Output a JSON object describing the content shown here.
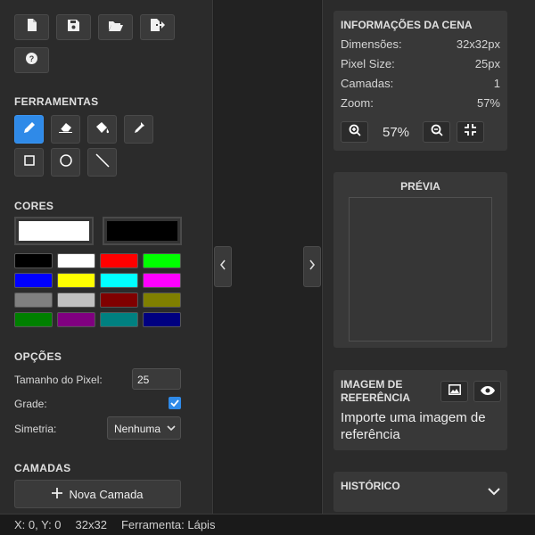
{
  "toolbar": {
    "file_buttons": [
      "new-file-icon",
      "save-icon",
      "open-folder-icon",
      "export-icon"
    ],
    "help_icon": "help-icon"
  },
  "tools": {
    "title": "FERRAMENTAS",
    "row1": [
      "pencil-icon",
      "eraser-icon",
      "fill-bucket-icon",
      "eyedropper-icon"
    ],
    "row2": [
      "square-icon",
      "circle-icon",
      "line-icon"
    ],
    "active": "pencil-icon",
    "accent": "#2f8ae8"
  },
  "colors": {
    "title": "CORES",
    "primary": "#ffffff",
    "secondary": "#000000",
    "palette": [
      "#000000",
      "#ffffff",
      "#ff0000",
      "#00ff00",
      "#0000ff",
      "#ffff00",
      "#00ffff",
      "#ff00ff",
      "#808080",
      "#c0c0c0",
      "#800000",
      "#808000",
      "#008000",
      "#800080",
      "#008080",
      "#000080"
    ]
  },
  "options": {
    "title": "OPÇÕES",
    "pixel_size_label": "Tamanho do Pixel:",
    "pixel_size_value": "25",
    "grid_label": "Grade:",
    "grid_checked": true,
    "symmetry_label": "Simetria:",
    "symmetry_value": "Nenhuma"
  },
  "layers": {
    "title": "CAMADAS",
    "new_layer_label": "Nova Camada"
  },
  "scene_info": {
    "title": "INFORMAÇÕES DA CENA",
    "rows": [
      {
        "label": "Dimensões:",
        "value": "32x32px"
      },
      {
        "label": "Pixel Size:",
        "value": "25px"
      },
      {
        "label": "Camadas:",
        "value": "1"
      },
      {
        "label": "Zoom:",
        "value": "57%"
      }
    ],
    "zoom_value": "57%"
  },
  "preview": {
    "title": "PRÉVIA"
  },
  "reference": {
    "title_line1": "IMAGEM DE",
    "title_line2": "REFERÊNCIA",
    "message": "Importe uma imagem de referência"
  },
  "history": {
    "title": "HISTÓRICO"
  },
  "status": {
    "coords": "X: 0, Y: 0",
    "size": "32x32",
    "tool": "Ferramenta: Lápis"
  }
}
